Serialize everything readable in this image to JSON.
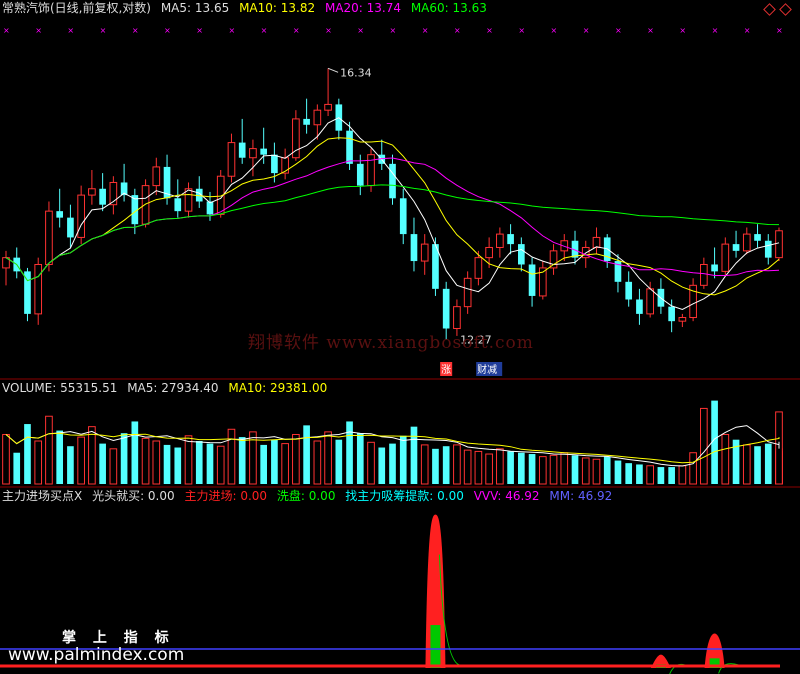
{
  "colors": {
    "up": "#ff3232",
    "down": "#54ffff",
    "ma5": "#ffffff",
    "ma10": "#ffff00",
    "ma20": "#ff00ff",
    "ma60": "#00ff00",
    "separator": "#8b0000",
    "label": "#dddddd",
    "red": "#ff2020",
    "green": "#00c800",
    "cyan": "#00ffff",
    "magenta": "#ff00ff",
    "blue": "#4040ff"
  },
  "header": {
    "title": "常熟汽饰(日线,前复权,对数)",
    "ma5": "MA5: 13.65",
    "ma10": "MA10: 13.82",
    "ma20": "MA20: 13.74",
    "ma60": "MA60: 13.63"
  },
  "price_panel": {
    "high_label": "16.34",
    "low_label": "12.27",
    "flag_rise": "涨",
    "flag_text": "财减",
    "watermark": "翔博软件 www.xiangbosoft.com"
  },
  "volume_header": {
    "vol": "VOLUME: 55315.51",
    "ma5": "MA5: 27934.40",
    "ma10": "MA10: 29381.00"
  },
  "indicator_header": {
    "title": "主力进场买点X",
    "guangtou": "光头就买: 0.00",
    "zhuli": "主力进场: 0.00",
    "xipan": "洗盘: 0.00",
    "zhao": "找主力吸筹提款: 0.00",
    "vvv": "VVV: 46.92",
    "mm": "MM: 46.92"
  },
  "footer": {
    "brand": "掌 上 指 标",
    "url": "www.palmindex.com"
  },
  "chart_data": [
    {
      "type": "candlestick",
      "title": "常熟汽饰(日线,前复权,对数)",
      "y_scale": "log",
      "ylim": [
        11.7,
        17.2
      ],
      "annotations": [
        {
          "text": "16.34",
          "kind": "highest"
        },
        {
          "text": "12.27",
          "kind": "lowest"
        }
      ],
      "ohlc": [
        [
          13.1,
          13.35,
          12.85,
          13.25
        ],
        [
          13.25,
          13.4,
          12.95,
          13.05
        ],
        [
          13.05,
          13.1,
          12.35,
          12.45
        ],
        [
          12.45,
          13.25,
          12.3,
          13.15
        ],
        [
          13.15,
          14.1,
          13.05,
          13.95
        ],
        [
          13.95,
          14.3,
          13.7,
          13.85
        ],
        [
          13.85,
          14.05,
          13.4,
          13.55
        ],
        [
          13.55,
          14.35,
          13.45,
          14.2
        ],
        [
          14.2,
          14.6,
          14.05,
          14.3
        ],
        [
          14.3,
          14.55,
          13.95,
          14.05
        ],
        [
          14.05,
          14.5,
          13.9,
          14.4
        ],
        [
          14.4,
          14.7,
          14.1,
          14.2
        ],
        [
          14.2,
          14.3,
          13.6,
          13.75
        ],
        [
          13.75,
          14.45,
          13.7,
          14.35
        ],
        [
          14.35,
          14.8,
          14.2,
          14.65
        ],
        [
          14.65,
          14.85,
          14.05,
          14.15
        ],
        [
          14.15,
          14.45,
          13.85,
          13.95
        ],
        [
          13.95,
          14.4,
          13.85,
          14.3
        ],
        [
          14.3,
          14.5,
          14.0,
          14.1
        ],
        [
          14.1,
          14.25,
          13.8,
          13.9
        ],
        [
          13.9,
          14.6,
          13.85,
          14.5
        ],
        [
          14.5,
          15.2,
          14.4,
          15.05
        ],
        [
          15.05,
          15.45,
          14.7,
          14.8
        ],
        [
          14.8,
          15.1,
          14.5,
          14.95
        ],
        [
          14.95,
          15.3,
          14.7,
          14.85
        ],
        [
          14.85,
          15.05,
          14.4,
          14.55
        ],
        [
          14.55,
          14.95,
          14.45,
          14.8
        ],
        [
          14.8,
          15.6,
          14.75,
          15.45
        ],
        [
          15.45,
          15.8,
          15.2,
          15.35
        ],
        [
          15.35,
          15.7,
          15.1,
          15.6
        ],
        [
          15.6,
          16.34,
          15.5,
          15.7
        ],
        [
          15.7,
          15.8,
          15.1,
          15.25
        ],
        [
          15.25,
          15.4,
          14.6,
          14.7
        ],
        [
          14.7,
          14.85,
          14.2,
          14.35
        ],
        [
          14.35,
          14.95,
          14.25,
          14.85
        ],
        [
          14.85,
          15.1,
          14.6,
          14.7
        ],
        [
          14.7,
          14.85,
          14.05,
          14.15
        ],
        [
          14.15,
          14.3,
          13.45,
          13.6
        ],
        [
          13.6,
          13.85,
          13.05,
          13.2
        ],
        [
          13.2,
          13.6,
          13.0,
          13.45
        ],
        [
          13.45,
          13.55,
          12.7,
          12.8
        ],
        [
          12.8,
          12.9,
          12.1,
          12.25
        ],
        [
          12.25,
          12.65,
          12.15,
          12.55
        ],
        [
          12.55,
          13.05,
          12.45,
          12.95
        ],
        [
          12.95,
          13.35,
          12.85,
          13.25
        ],
        [
          13.25,
          13.55,
          13.1,
          13.4
        ],
        [
          13.4,
          13.7,
          13.25,
          13.6
        ],
        [
          13.6,
          13.75,
          13.3,
          13.45
        ],
        [
          13.45,
          13.55,
          13.05,
          13.15
        ],
        [
          13.15,
          13.25,
          12.55,
          12.7
        ],
        [
          12.7,
          13.2,
          12.65,
          13.1
        ],
        [
          13.1,
          13.45,
          13.0,
          13.35
        ],
        [
          13.35,
          13.6,
          13.2,
          13.5
        ],
        [
          13.5,
          13.65,
          13.15,
          13.25
        ],
        [
          13.25,
          13.5,
          13.1,
          13.4
        ],
        [
          13.4,
          13.7,
          13.3,
          13.55
        ],
        [
          13.55,
          13.6,
          13.1,
          13.2
        ],
        [
          13.2,
          13.3,
          12.75,
          12.9
        ],
        [
          12.9,
          13.05,
          12.55,
          12.65
        ],
        [
          12.65,
          12.8,
          12.3,
          12.45
        ],
        [
          12.45,
          12.9,
          12.4,
          12.8
        ],
        [
          12.8,
          12.95,
          12.45,
          12.55
        ],
        [
          12.55,
          12.65,
          12.2,
          12.35
        ],
        [
          12.35,
          12.45,
          12.27,
          12.4
        ],
        [
          12.4,
          12.95,
          12.35,
          12.85
        ],
        [
          12.85,
          13.25,
          12.8,
          13.15
        ],
        [
          13.15,
          13.4,
          12.95,
          13.05
        ],
        [
          13.05,
          13.55,
          13.0,
          13.45
        ],
        [
          13.45,
          13.65,
          13.25,
          13.35
        ],
        [
          13.35,
          13.7,
          13.3,
          13.6
        ],
        [
          13.6,
          13.75,
          13.4,
          13.5
        ],
        [
          13.5,
          13.6,
          13.15,
          13.25
        ],
        [
          13.25,
          13.7,
          13.2,
          13.65
        ]
      ],
      "ma_series": [
        {
          "name": "MA5",
          "period": 5
        },
        {
          "name": "MA10",
          "period": 10
        },
        {
          "name": "MA20",
          "period": 20
        },
        {
          "name": "MA60",
          "period": 60
        }
      ]
    },
    {
      "type": "bar",
      "title": "VOLUME",
      "values": [
        38000,
        24000,
        46000,
        33000,
        52000,
        41000,
        29000,
        36000,
        44000,
        31000,
        27000,
        39000,
        48000,
        35000,
        33000,
        30000,
        28000,
        37000,
        33000,
        31000,
        29000,
        42000,
        36000,
        40000,
        30000,
        34000,
        31000,
        38000,
        45000,
        33000,
        40000,
        34000,
        48000,
        39000,
        32000,
        28000,
        31000,
        37000,
        44000,
        30000,
        27000,
        29000,
        30000,
        26000,
        25000,
        23000,
        27000,
        25000,
        24000,
        23000,
        21000,
        22000,
        24000,
        22000,
        20000,
        19000,
        21000,
        18000,
        16000,
        15000,
        14000,
        13000,
        13000,
        14000,
        24000,
        58000,
        64000,
        38000,
        34000,
        30000,
        29000,
        31000,
        27000,
        24000,
        25000,
        55315
      ],
      "ylim": [
        0,
        66000
      ]
    },
    {
      "type": "area",
      "title": "主力进场买点X",
      "series": [
        {
          "name": "主力进场",
          "values": [
            0,
            0,
            0,
            0,
            0,
            0,
            0,
            0,
            0,
            0,
            0,
            0,
            0,
            0,
            0,
            0,
            0,
            0,
            0,
            0,
            0,
            0,
            0,
            0,
            0,
            0,
            0,
            0,
            0,
            0,
            0,
            0,
            0,
            0,
            0,
            0,
            0,
            0,
            0,
            0,
            160,
            0,
            0,
            0,
            0,
            0,
            0,
            0,
            0,
            0,
            0,
            0,
            0,
            0,
            0,
            0,
            0,
            0,
            0,
            0,
            0,
            14,
            0,
            0,
            0,
            0,
            36,
            0,
            0,
            0,
            0,
            0,
            0,
            0,
            0,
            0
          ]
        },
        {
          "name": "VVV",
          "values": [
            0,
            0,
            0,
            0,
            0,
            0,
            0,
            0,
            0,
            0,
            0,
            0,
            0,
            0,
            0,
            0,
            0,
            0,
            0,
            0,
            0,
            0,
            0,
            0,
            0,
            0,
            0,
            0,
            0,
            0,
            0,
            0,
            0,
            0,
            0,
            0,
            0,
            0,
            0,
            0,
            0,
            0,
            0,
            0,
            0,
            0,
            0,
            0,
            0,
            0,
            0,
            0,
            0,
            0,
            0,
            0,
            0,
            0,
            0,
            0,
            0,
            0,
            0,
            0,
            0,
            0,
            0,
            0,
            0,
            0,
            0,
            0,
            0,
            0,
            0,
            46.92
          ]
        }
      ]
    }
  ]
}
